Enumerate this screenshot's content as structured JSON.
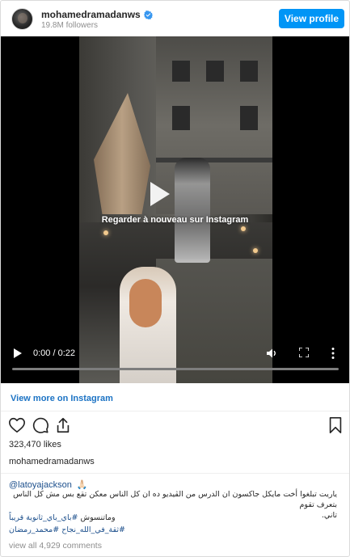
{
  "header": {
    "username": "mohamedramadanws",
    "followers": "19.8M followers",
    "view_profile_label": "View profile"
  },
  "video": {
    "watch_again_label": "Regarder à nouveau sur Instagram",
    "current_time": "0:00",
    "duration": "0:22",
    "time_display": "0:00 / 0:22",
    "progress_fraction": 0
  },
  "links": {
    "view_more_label": "View more on Instagram"
  },
  "actions": {
    "like_icon": "heart-icon",
    "comment_icon": "comment-icon",
    "share_icon": "share-icon",
    "save_icon": "bookmark-icon"
  },
  "stats": {
    "likes": "323,470 likes"
  },
  "caption": {
    "owner": "mohamedramadanws",
    "mention": "@latoyajackson",
    "mention_emoji": "🙏🏻",
    "text_line1": "ياريت تبلغوا أخت مايكل جاكسون ان الدرس من الڤيديو ده ان كل الناس معكن تقع بس مش كل الناس بتعرف تقوم",
    "text_line2": "تاني.",
    "hashtags_line1_plain": "وماتنسوش ",
    "hashtags_line1_tags": "#باي_باي_ثانوية قريباً",
    "hashtags_line2": "#ثقة_في_الله_نجاح #محمد_رمضان"
  },
  "comments": {
    "view_all_label": "view all 4,929 comments"
  },
  "colors": {
    "accent": "#0095f6",
    "link": "#1c73c4",
    "hashtag": "#1c4f8c",
    "muted": "#8e8e8e",
    "text": "#262626"
  }
}
